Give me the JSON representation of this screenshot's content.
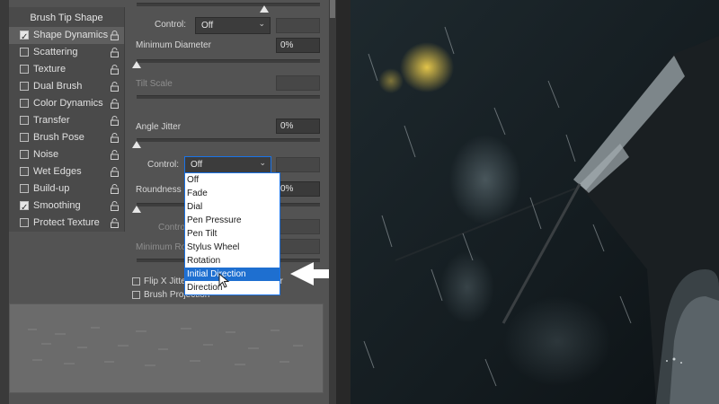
{
  "panel": {
    "list_header": "Brush Tip Shape",
    "items": [
      {
        "label": "Shape Dynamics",
        "checked": true
      },
      {
        "label": "Scattering",
        "checked": false
      },
      {
        "label": "Texture",
        "checked": false
      },
      {
        "label": "Dual Brush",
        "checked": false
      },
      {
        "label": "Color Dynamics",
        "checked": false
      },
      {
        "label": "Transfer",
        "checked": false
      },
      {
        "label": "Brush Pose",
        "checked": false
      },
      {
        "label": "Noise",
        "checked": false
      },
      {
        "label": "Wet Edges",
        "checked": false
      },
      {
        "label": "Build-up",
        "checked": false
      },
      {
        "label": "Smoothing",
        "checked": true
      },
      {
        "label": "Protect Texture",
        "checked": false
      }
    ]
  },
  "settings": {
    "control_label_1": "Control:",
    "control_value_1": "Off",
    "min_diameter_label": "Minimum Diameter",
    "min_diameter_value": "0%",
    "tilt_scale_label": "Tilt Scale",
    "angle_jitter_label": "Angle Jitter",
    "angle_jitter_value": "0%",
    "control_label_2": "Control:",
    "control_value_2": "Off",
    "roundness_label": "Roundness",
    "roundness_value": "0%",
    "control_label_3": "Contro",
    "min_roundness_label": "Minimum Ro",
    "flip_x_label": "Flip X Jitte",
    "flip_y_tail": "er",
    "brush_projection_label": "Brush Projection"
  },
  "dropdown": {
    "options": [
      "Off",
      "Fade",
      "Dial",
      "Pen Pressure",
      "Pen Tilt",
      "Stylus Wheel",
      "Rotation",
      "Initial Direction",
      "Direction"
    ],
    "highlighted": "Initial Direction"
  },
  "colors": {
    "panel_bg": "#535353",
    "highlight": "#1e6fd0",
    "dropdown_border": "#1a73e8"
  }
}
